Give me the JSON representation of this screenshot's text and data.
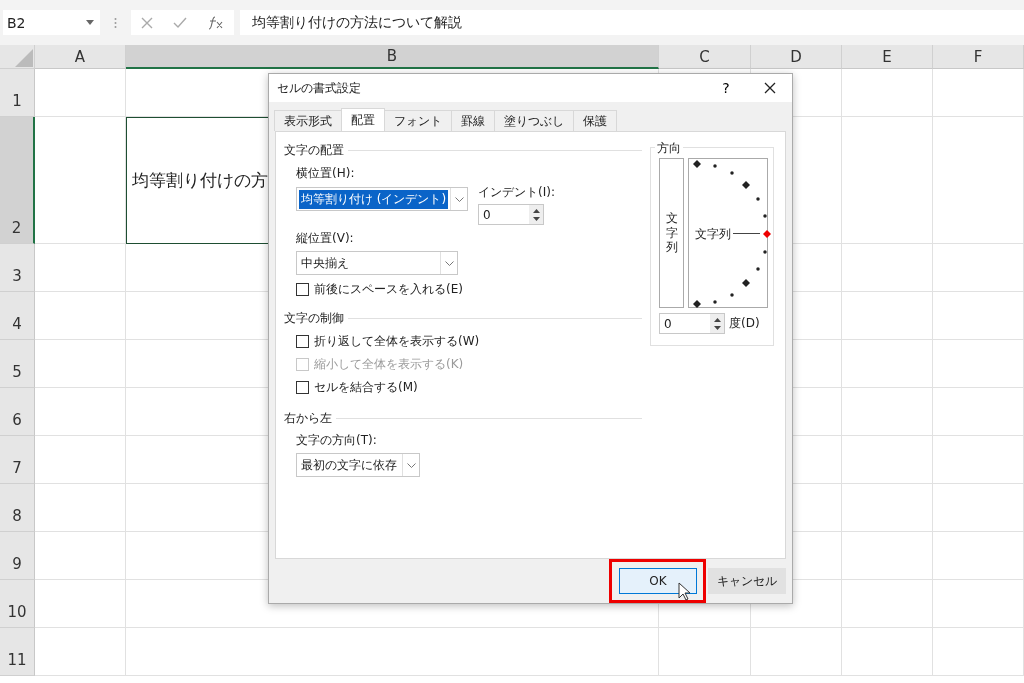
{
  "name_box": {
    "value": "B2"
  },
  "formula_bar": {
    "value": "均等割り付けの方法について解説"
  },
  "columns": [
    {
      "label": "A",
      "selected": false
    },
    {
      "label": "B",
      "selected": true
    },
    {
      "label": "C",
      "selected": false
    },
    {
      "label": "D",
      "selected": false
    },
    {
      "label": "E",
      "selected": false
    },
    {
      "label": "F",
      "selected": false
    }
  ],
  "rows": [
    {
      "label": "1",
      "selected": false
    },
    {
      "label": "2",
      "selected": true
    },
    {
      "label": "3",
      "selected": false
    },
    {
      "label": "4",
      "selected": false
    },
    {
      "label": "5",
      "selected": false
    },
    {
      "label": "6",
      "selected": false
    },
    {
      "label": "7",
      "selected": false
    },
    {
      "label": "8",
      "selected": false
    },
    {
      "label": "9",
      "selected": false
    },
    {
      "label": "10",
      "selected": false
    },
    {
      "label": "11",
      "selected": false
    }
  ],
  "active_cell": {
    "text": "均等割り付けの方"
  },
  "dialog": {
    "title": "セルの書式設定",
    "help": "?",
    "tabs": [
      {
        "label": "表示形式",
        "selected": false
      },
      {
        "label": "配置",
        "selected": true
      },
      {
        "label": "フォント",
        "selected": false
      },
      {
        "label": "罫線",
        "selected": false
      },
      {
        "label": "塗りつぶし",
        "selected": false
      },
      {
        "label": "保護",
        "selected": false
      }
    ],
    "text_alignment": {
      "heading": "文字の配置",
      "horizontal_label": "横位置(H):",
      "horizontal_value": "均等割り付け (インデント)",
      "horizontal_highlighted": true,
      "indent_label": "インデント(I):",
      "indent_value": "0",
      "vertical_label": "縦位置(V):",
      "vertical_value": "中央揃え",
      "distributed": {
        "label": "前後にスペースを入れる(E)",
        "checked": false,
        "disabled": false
      }
    },
    "text_control": {
      "heading": "文字の制御",
      "options": [
        {
          "label": "折り返して全体を表示する(W)",
          "checked": false,
          "disabled": false
        },
        {
          "label": "縮小して全体を表示する(K)",
          "checked": false,
          "disabled": true
        },
        {
          "label": "セルを結合する(M)",
          "checked": false,
          "disabled": false
        }
      ]
    },
    "right_to_left": {
      "heading": "右から左",
      "direction_label": "文字の方向(T):",
      "direction_value": "最初の文字に依存"
    },
    "orientation": {
      "heading": "方向",
      "vertical_text": "文字列",
      "dial_text": "文字列",
      "degrees_value": "0",
      "degrees_label": "度(D)"
    },
    "buttons": [
      {
        "label": "OK",
        "kind": "default"
      },
      {
        "label": "キャンセル",
        "kind": "normal"
      }
    ]
  }
}
